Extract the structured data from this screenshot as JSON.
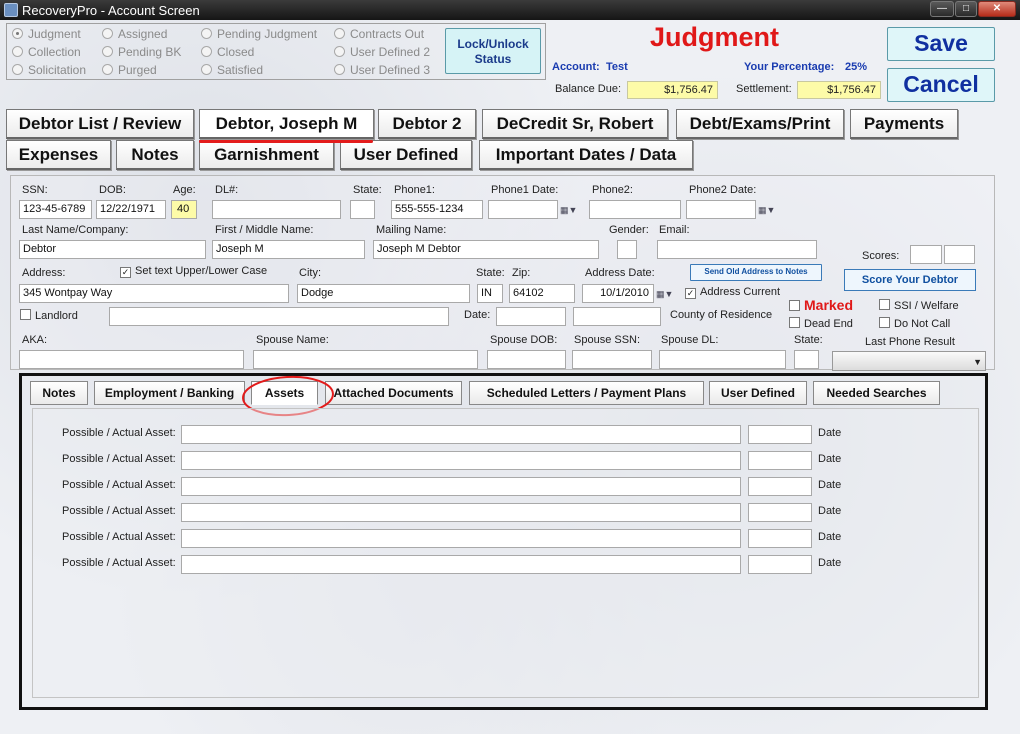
{
  "window": {
    "title": "RecoveryPro - Account Screen"
  },
  "status_options": [
    {
      "label": "Judgment",
      "selected": true
    },
    {
      "label": "Collection",
      "selected": false
    },
    {
      "label": "Solicitation",
      "selected": false
    },
    {
      "label": "Assigned",
      "selected": false
    },
    {
      "label": "Pending BK",
      "selected": false
    },
    {
      "label": "Purged",
      "selected": false
    },
    {
      "label": "Pending Judgment",
      "selected": false
    },
    {
      "label": "Closed",
      "selected": false
    },
    {
      "label": "Satisfied",
      "selected": false
    },
    {
      "label": "Contracts Out",
      "selected": false
    },
    {
      "label": "User Defined 2",
      "selected": false
    },
    {
      "label": "User Defined 3",
      "selected": false
    }
  ],
  "lock_button": {
    "line1": "Lock/Unlock",
    "line2": "Status"
  },
  "header": {
    "status_title": "Judgment",
    "account_label": "Account:",
    "account_value": "Test",
    "percentage_label": "Your Percentage:",
    "percentage_value": "25%",
    "balance_label": "Balance Due:",
    "balance_value": "$1,756.47",
    "settlement_label": "Settlement:",
    "settlement_value": "$1,756.47",
    "save_label": "Save",
    "cancel_label": "Cancel"
  },
  "main_tabs_row1": [
    "Debtor List / Review",
    "Debtor, Joseph M",
    "Debtor 2",
    "DeCredit Sr, Robert",
    "Debt/Exams/Print",
    "Payments"
  ],
  "main_tabs_row2": [
    "Expenses",
    "Notes",
    "Garnishment",
    "User Defined",
    "Important Dates / Data"
  ],
  "active_main_tab": "Debtor, Joseph M",
  "form": {
    "labels": {
      "ssn": "SSN:",
      "dob": "DOB:",
      "age": "Age:",
      "dl": "DL#:",
      "state": "State:",
      "phone1": "Phone1:",
      "phone1_date": "Phone1 Date:",
      "phone2": "Phone2:",
      "phone2_date": "Phone2 Date:",
      "last_name": "Last Name/Company:",
      "first_name": "First / Middle Name:",
      "mailing_name": "Mailing Name:",
      "gender": "Gender:",
      "email": "Email:",
      "scores": "Scores:",
      "address": "Address:",
      "set_text": "Set text Upper/Lower Case",
      "city": "City:",
      "state2": "State:",
      "zip": "Zip:",
      "address_date": "Address Date:",
      "address_current": "Address Current",
      "landlord": "Landlord",
      "date": "Date:",
      "county": "County of Residence",
      "marked": "Marked",
      "ssi": "SSI / Welfare",
      "dead_end": "Dead End",
      "do_not_call": "Do Not Call",
      "aka": "AKA:",
      "spouse_name": "Spouse Name:",
      "spouse_dob": "Spouse DOB:",
      "spouse_ssn": "Spouse SSN:",
      "spouse_dl": "Spouse DL:",
      "state3": "State:",
      "last_phone_result": "Last Phone Result"
    },
    "values": {
      "ssn": "123-45-6789",
      "dob": "12/22/1971",
      "age": "40",
      "phone1": "555-555-1234",
      "last_name": "Debtor",
      "first_name": "Joseph M",
      "mailing_name": "Joseph M Debtor",
      "address": "345 Wontpay Way",
      "city": "Dodge",
      "state": "IN",
      "zip": "64102",
      "address_date": "10/1/2010"
    },
    "checks": {
      "set_text": true,
      "address_current": true,
      "landlord": false,
      "marked": false,
      "ssi": false,
      "dead_end": false,
      "do_not_call": false
    },
    "send_old_address_label": "Send Old Address to Notes",
    "score_button_label": "Score Your Debtor"
  },
  "sub_tabs": [
    "Notes",
    "Employment / Banking",
    "Assets",
    "Attached Documents",
    "Scheduled Letters  /  Payment Plans",
    "User Defined",
    "Needed Searches"
  ],
  "active_sub_tab": "Assets",
  "assets": {
    "row_label": "Possible / Actual Asset:",
    "date_label": "Date",
    "rows": [
      "",
      "",
      "",
      "",
      "",
      ""
    ]
  },
  "colors": {
    "accent_red": "#e01818",
    "save_blue": "#1030a0",
    "highlight_yellow": "#fdfba8"
  }
}
